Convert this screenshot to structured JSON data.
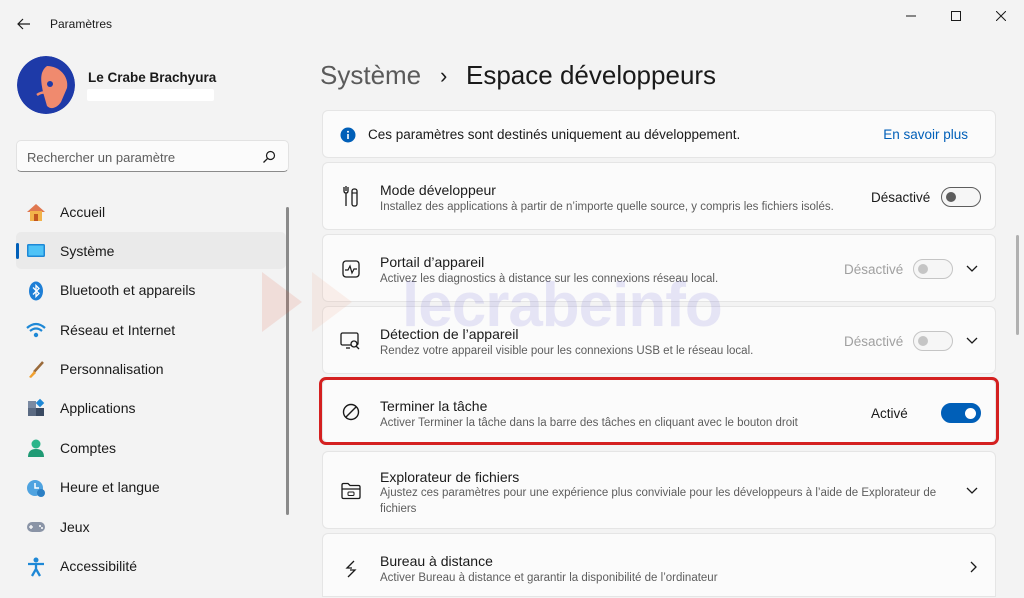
{
  "window": {
    "title": "Paramètres",
    "controls": [
      "minimize",
      "maximize",
      "close"
    ]
  },
  "profile": {
    "name": "Le Crabe Brachyura"
  },
  "search": {
    "placeholder": "Rechercher un paramètre",
    "value": ""
  },
  "nav": {
    "items": [
      {
        "label": "Accueil",
        "icon": "home-icon"
      },
      {
        "label": "Système",
        "icon": "system-icon",
        "active": true
      },
      {
        "label": "Bluetooth et appareils",
        "icon": "bluetooth-icon"
      },
      {
        "label": "Réseau et Internet",
        "icon": "wifi-icon"
      },
      {
        "label": "Personnalisation",
        "icon": "brush-icon"
      },
      {
        "label": "Applications",
        "icon": "apps-icon"
      },
      {
        "label": "Comptes",
        "icon": "account-icon"
      },
      {
        "label": "Heure et langue",
        "icon": "clock-globe-icon"
      },
      {
        "label": "Jeux",
        "icon": "gamepad-icon"
      },
      {
        "label": "Accessibilité",
        "icon": "accessibility-icon"
      }
    ]
  },
  "breadcrumb": {
    "parent": "Système",
    "separator": "›",
    "current": "Espace développeurs"
  },
  "info_banner": {
    "text": "Ces paramètres sont destinés uniquement au développement.",
    "link": "En savoir plus",
    "icon": "info-icon"
  },
  "settings": [
    {
      "title": "Mode développeur",
      "desc": "Installez des applications à partir de n’importe quelle source, y compris les fichiers isolés.",
      "state": "Désactivé",
      "toggle": "off",
      "icon": "developer-tools-icon"
    },
    {
      "title": "Portail d’appareil",
      "desc": "Activez les diagnostics à distance sur les connexions réseau local.",
      "state": "Désactivé",
      "toggle": "off-disabled",
      "icon": "device-portal-icon",
      "expand": true
    },
    {
      "title": "Détection de l’appareil",
      "desc": "Rendez votre appareil visible pour les connexions USB et le réseau local.",
      "state": "Désactivé",
      "toggle": "off-disabled",
      "icon": "device-discovery-icon",
      "expand": true
    },
    {
      "title": "Terminer la tâche",
      "desc": "Activer Terminer la tâche dans la barre des tâches en cliquant avec le bouton droit",
      "state": "Activé",
      "toggle": "on",
      "icon": "end-task-icon"
    },
    {
      "title": "Explorateur de fichiers",
      "desc": "Ajustez ces paramètres pour une expérience plus conviviale pour les développeurs à l’aide de Explorateur de fichiers",
      "icon": "folder-icon",
      "expand": true
    },
    {
      "title": "Bureau à distance",
      "desc": "Activer Bureau à distance et garantir la disponibilité de l’ordinateur",
      "icon": "remote-desktop-icon",
      "navigate": true
    }
  ],
  "watermark": "lecrabeinfo",
  "colors": {
    "accent": "#005fb8",
    "highlight_border": "#d42020",
    "background": "#f3f3f3",
    "card": "#fbfbfb"
  }
}
